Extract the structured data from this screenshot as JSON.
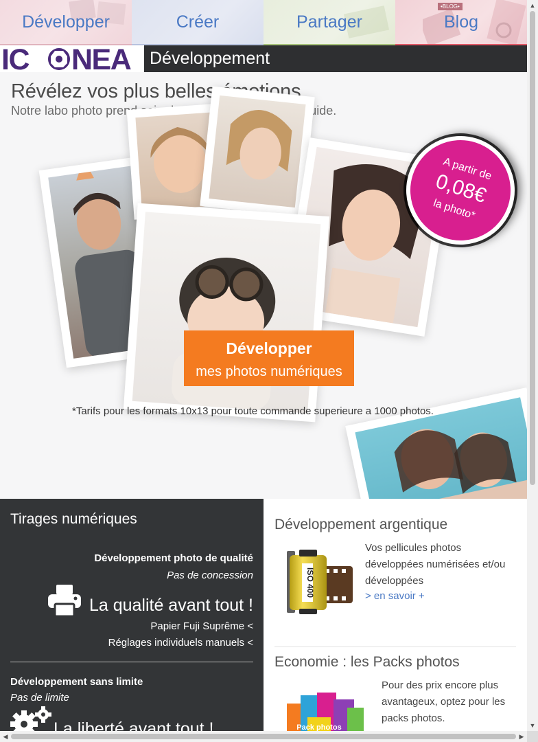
{
  "nav": {
    "tabs": [
      {
        "label": "Développer"
      },
      {
        "label": "Créer"
      },
      {
        "label": "Partager"
      },
      {
        "label": "Blog"
      }
    ],
    "blog_tag": "•BLOG•"
  },
  "brand": {
    "logo_text": "ICONEA",
    "section_title": "Développement",
    "logo_color": "#4a2a7a"
  },
  "hero": {
    "title": "Révélez vos plus belles émotions",
    "subtitle": "Notre labo photo prend soin de vos clichés, suivez le guide.",
    "badge": {
      "line1": "A partir de",
      "price": "0,08€",
      "line3": "la photo*",
      "color": "#d81f8f"
    },
    "cta": {
      "line1": "Développer",
      "line2": "mes photos numériques",
      "color": "#f47b20"
    },
    "note": "*Tarifs pour les formats 10x13 pour toute commande superieure a 1000 photos."
  },
  "left_panel": {
    "title": "Tirages numériques",
    "block1": {
      "heading": "Développement photo de qualité",
      "tagline": "Pas de concession",
      "slogan": "La qualité avant tout !",
      "features": [
        "Papier Fuji Suprême <",
        "Réglages individuels manuels <"
      ]
    },
    "block2": {
      "heading": "Développement sans limite",
      "tagline": "Pas de limite",
      "slogan": "La liberté avant tout !"
    }
  },
  "right_panel": {
    "argentique": {
      "title": "Développement argentique",
      "text": "Vos pellicules photos développées numérisées et/ou développées",
      "link": "> en savoir +",
      "film_label": "ISO 400"
    },
    "packs": {
      "title": "Economie : les Packs photos",
      "text": "Pour des prix encore plus avantageux, optez pour les packs photos.",
      "pack_label": "Pack photos"
    }
  },
  "icons": [
    "printer-icon",
    "gears-icon",
    "film-roll-icon",
    "photo-packs-icon"
  ]
}
